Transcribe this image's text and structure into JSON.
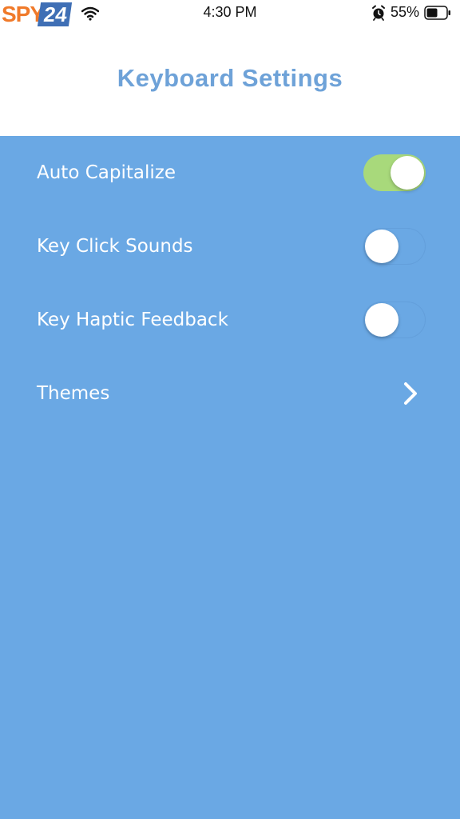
{
  "status_bar": {
    "watermark_left": "SPY",
    "watermark_right": "24",
    "time": "4:30 PM",
    "battery_percent": "55%",
    "icons": [
      "wifi-icon",
      "alarm-icon",
      "battery-icon"
    ]
  },
  "header": {
    "title": "Keyboard Settings"
  },
  "settings": {
    "items": [
      {
        "label": "Auto Capitalize",
        "control": "toggle",
        "on": true
      },
      {
        "label": "Key Click Sounds",
        "control": "toggle",
        "on": false
      },
      {
        "label": "Key Haptic Feedback",
        "control": "toggle",
        "on": false
      },
      {
        "label": "Themes",
        "control": "chevron"
      }
    ]
  },
  "colors": {
    "background": "#6aa8e4",
    "title": "#6ea2d8",
    "toggle_on": "#a8d97b",
    "header_bg": "#ffffff"
  }
}
